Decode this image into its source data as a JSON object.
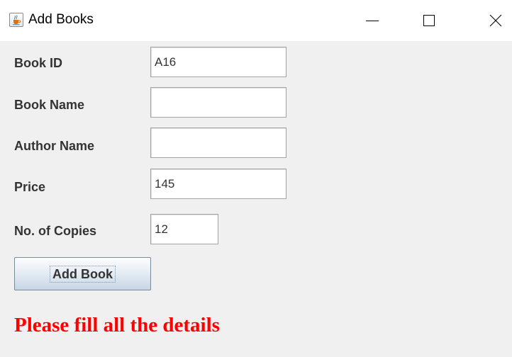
{
  "window": {
    "title": "Add Books",
    "icon": "java-cup-icon",
    "controls": [
      "minimize-icon",
      "maximize-icon",
      "close-icon"
    ]
  },
  "form": {
    "book_id": {
      "label": "Book ID",
      "value": "A16"
    },
    "book_name": {
      "label": "Book Name",
      "value": ""
    },
    "author_name": {
      "label": "Author Name",
      "value": ""
    },
    "price": {
      "label": "Price",
      "value": "145"
    },
    "copies": {
      "label": "No. of Copies",
      "value": "12"
    },
    "submit_label": "Add Book"
  },
  "status": {
    "message": "Please fill all the details",
    "color": "#ff0000"
  }
}
